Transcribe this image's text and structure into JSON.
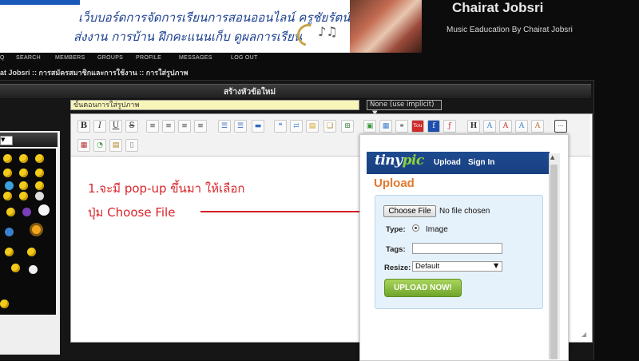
{
  "banner": {
    "line1": "เว็บบอร์ดการจัดการเรียนการสอนออนไลน์  ครูชัยรัตน์ จบศรี",
    "line2": "ส่งงาน การบ้าน ฝึกคะแนนเก็บ ดูผลการเรียน",
    "notes_glyph": "♪♫"
  },
  "site": {
    "title": "Chairat Jobsri",
    "subtitle": "Music Eaducation By Chairat Jobsri"
  },
  "nav": {
    "items": [
      "Q",
      "SEARCH",
      "MEMBERS",
      "GROUPS",
      "PROFILE",
      "MESSAGES",
      "LOG OUT"
    ]
  },
  "breadcrumb": "at Jobsri :: การสมัครสมาชิกและการใช้งาน :: การใส่รูปภาพ",
  "form": {
    "header": "สร้างหัวข้อใหม่",
    "subject_value": "ขั้นตอนการใส่รูปภาพ",
    "font_select": "None (use implicit)",
    "font_select_arrow": "▼"
  },
  "smiley_panel": {
    "select_arrow": "▼"
  },
  "toolbar": {
    "bold": "B",
    "italic": "I",
    "underline": "U",
    "strike": "S",
    "heading": "H",
    "more": "···"
  },
  "editor": {
    "line1": "1.จะมี pop-up ขึ้นมา ให้เลือก",
    "line2": "ปุ่ม Choose File",
    "resize_grip": "◢"
  },
  "tinypic": {
    "logo_main": "tiny",
    "logo_accent": "pic",
    "nav_upload": "Upload",
    "nav_signin": "Sign In",
    "title": "Upload",
    "choose_button": "Choose File",
    "no_file": "No file chosen",
    "type_label": "Type:",
    "type_value": "Image",
    "tags_label": "Tags:",
    "tags_value": "",
    "resize_label": "Resize:",
    "resize_value": "Default",
    "resize_arrow": "▼",
    "upload_button": "UPLOAD NOW!",
    "scroll_up": "▲"
  },
  "colors": {
    "annotation_red": "#d9252a",
    "tinypic_blue": "#1e4a8f",
    "tinypic_orange": "#e07a30",
    "upload_green": "#8cbf43",
    "subject_yellow": "#f7f5b8"
  }
}
